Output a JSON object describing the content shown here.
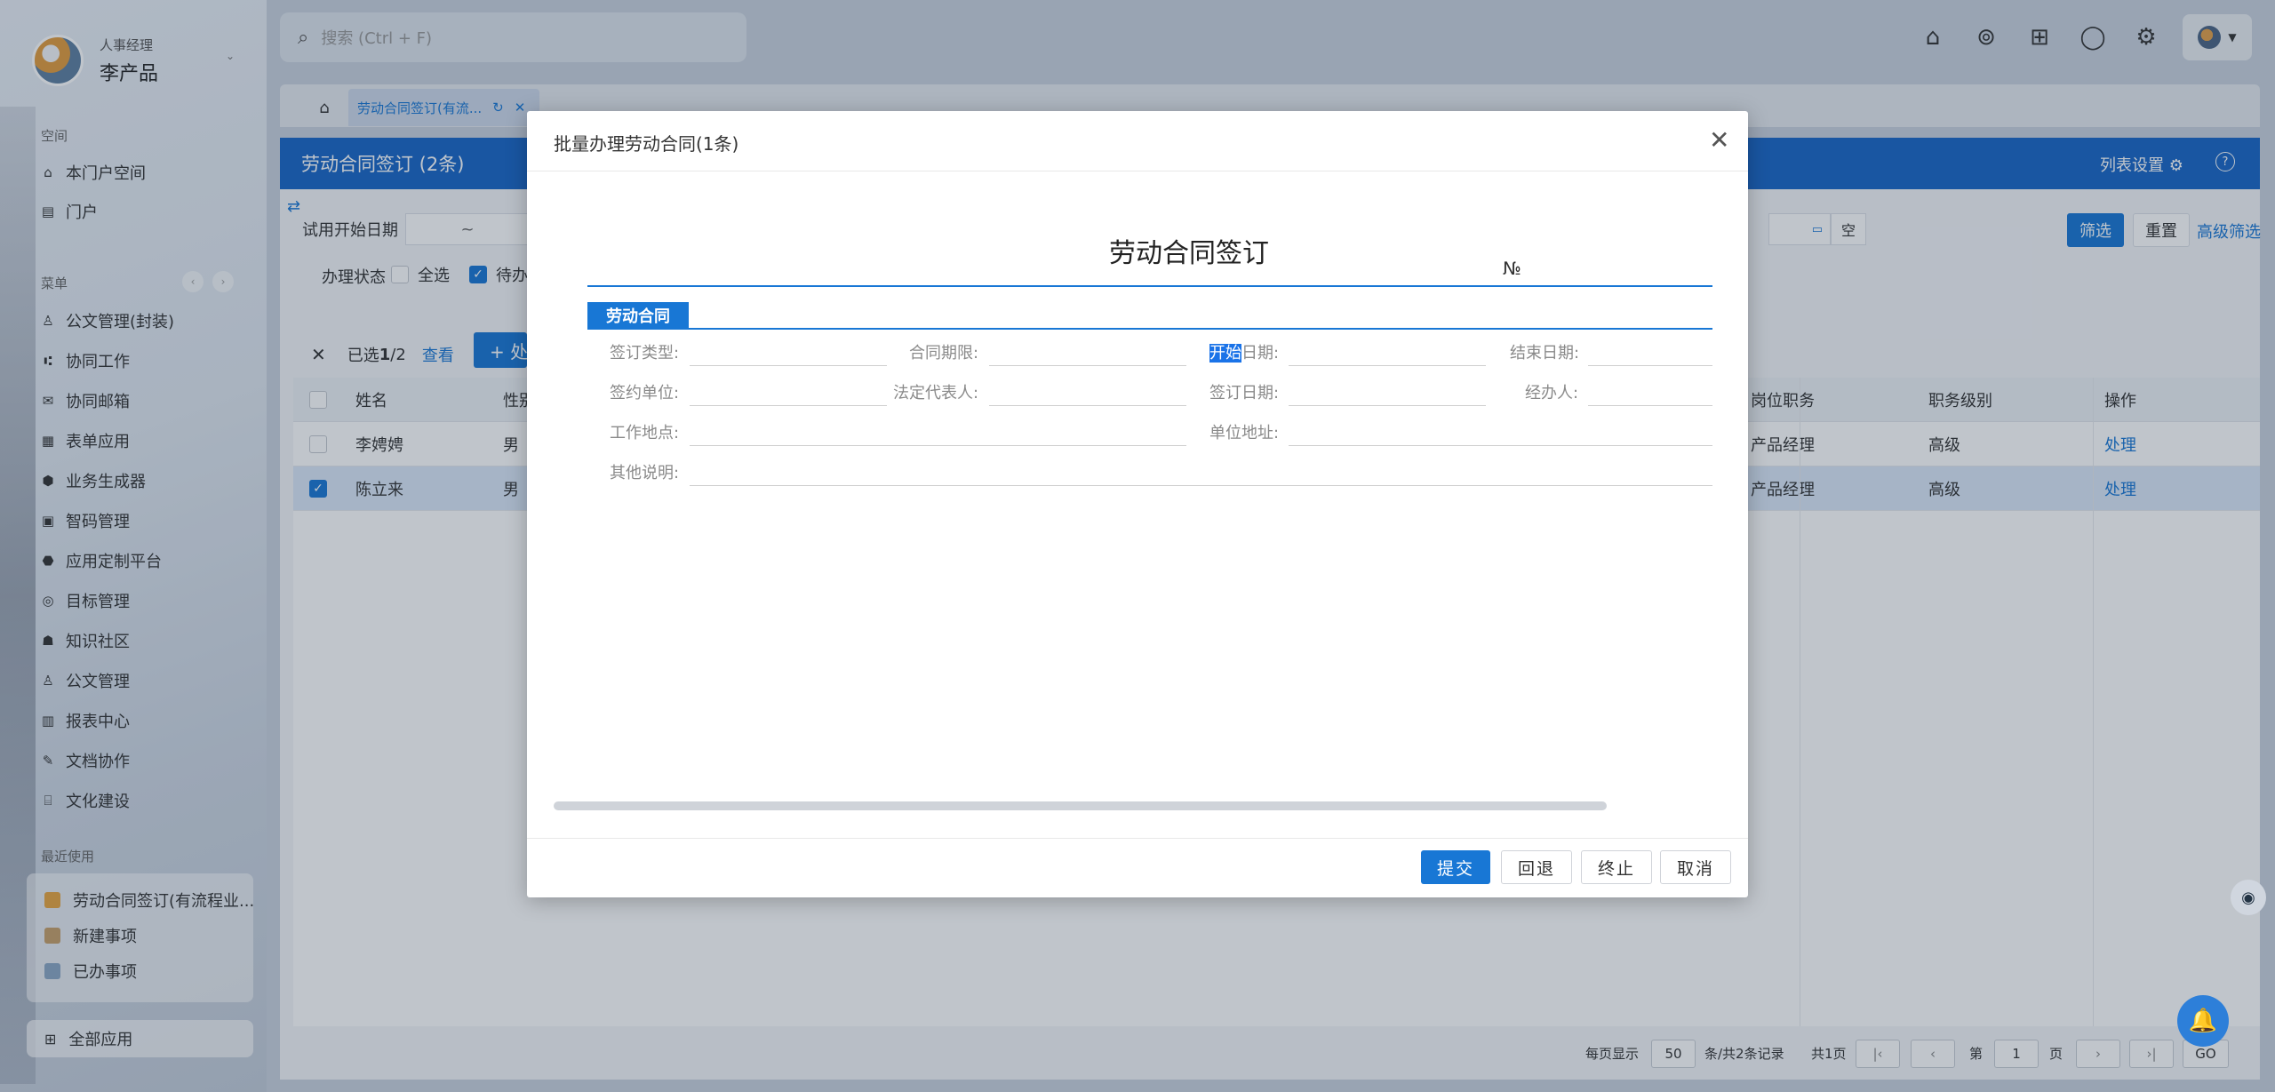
{
  "sidebar": {
    "user_role": "人事经理",
    "user_name": "李产品",
    "space_label": "空间",
    "space_items": [
      "本门户空间",
      "门户"
    ],
    "menu_label": "菜单",
    "menu_items": [
      "公文管理(封装)",
      "协同工作",
      "协同邮箱",
      "表单应用",
      "业务生成器",
      "智码管理",
      "应用定制平台",
      "目标管理",
      "知识社区",
      "公文管理",
      "报表中心",
      "文档协作",
      "文化建设"
    ],
    "recent_label": "最近使用",
    "recent_items": [
      "劳动合同签订(有流程业...",
      "新建事项",
      "已办事项"
    ],
    "all_apps": "全部应用"
  },
  "topbar": {
    "search_placeholder": "搜索 (Ctrl + F)"
  },
  "tabs": {
    "active_label": "劳动合同签订(有流..."
  },
  "main": {
    "title": "劳动合同签订 (2条)",
    "list_settings": "列表设置",
    "filter_label": "试用开始日期",
    "filter_sep": "~",
    "status_label": "办理状态",
    "all_label": "全选",
    "todo_label": "待办",
    "empty_label": "空",
    "btn_filter": "筛选",
    "btn_reset": "重置",
    "adv_filter": "高级筛选",
    "selected_prefix": "已选",
    "selected_count": "1",
    "selected_total": "/2",
    "view_label": "查看",
    "process_btn": "+ 处理",
    "columns": [
      "姓名",
      "性别",
      "岗位职务",
      "职务级别",
      "操作"
    ],
    "rows": [
      {
        "name": "李娉娉",
        "gender": "男",
        "post": "产品经理",
        "level": "高级",
        "action": "处理",
        "selected": false
      },
      {
        "name": "陈立来",
        "gender": "男",
        "post": "产品经理",
        "level": "高级",
        "action": "处理",
        "selected": true
      }
    ]
  },
  "pager": {
    "per_page_label": "每页显示",
    "per_page_value": "50",
    "records_label": "条/共2条记录",
    "pages_label": "共1页",
    "page_prefix": "第",
    "page_value": "1",
    "page_suffix": "页",
    "go": "GO"
  },
  "modal": {
    "title": "批量办理劳动合同(1条)",
    "form_title": "劳动合同签订",
    "form_no": "№",
    "section_tag": "劳动合同",
    "fields": {
      "sign_type": "签订类型:",
      "contract_term": "合同期限:",
      "start_date_hl": "开始",
      "start_date_rest": "日期:",
      "end_date": "结束日期:",
      "sign_unit": "签约单位:",
      "legal_rep": "法定代表人:",
      "sign_date": "签订日期:",
      "handler": "经办人:",
      "work_place": "工作地点:",
      "unit_address": "单位地址:",
      "other_notes": "其他说明:"
    },
    "buttons": {
      "submit": "提交",
      "back": "回退",
      "terminate": "终止",
      "cancel": "取消"
    }
  },
  "colors": {
    "accent": "#1877d5",
    "header_blue": "#1866c7"
  }
}
